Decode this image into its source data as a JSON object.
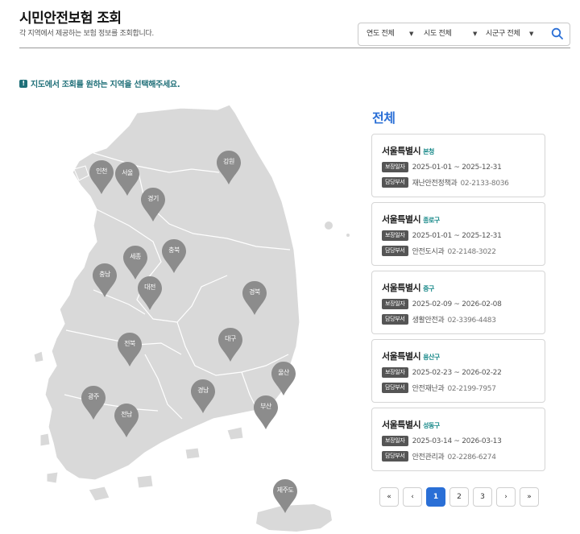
{
  "header": {
    "title": "시민안전보험 조회",
    "subtitle": "각 지역에서 제공하는 보험 정보를 조회합니다."
  },
  "filters": {
    "year": "연도 전체",
    "province": "시도 전체",
    "district": "시군구 전체",
    "caret": "▼",
    "search_icon": "search-icon"
  },
  "notice": {
    "icon": "!",
    "text": "지도에서 조회를 원하는 지역을 선택해주세요."
  },
  "map": {
    "land_color": "#d9d9d9",
    "border_color": "#ffffff",
    "pin_color": "#8c8c8c",
    "regions": [
      "인천",
      "서울",
      "강원",
      "경기",
      "세종",
      "충북",
      "충남",
      "대전",
      "경북",
      "전북",
      "대구",
      "울산",
      "광주",
      "경남",
      "부산",
      "전남",
      "제주도"
    ]
  },
  "list": {
    "title": "전체",
    "labels": {
      "period": "보장일자",
      "dept": "담당부서"
    },
    "cards": [
      {
        "city": "서울특별시",
        "district": "본청",
        "period": "2025-01-01 ~ 2025-12-31",
        "dept": "재난안전정책과",
        "phone": "02-2133-8036"
      },
      {
        "city": "서울특별시",
        "district": "종로구",
        "period": "2025-01-01 ~ 2025-12-31",
        "dept": "안전도시과",
        "phone": "02-2148-3022"
      },
      {
        "city": "서울특별시",
        "district": "중구",
        "period": "2025-02-09 ~ 2026-02-08",
        "dept": "생활안전과",
        "phone": "02-3396-4483"
      },
      {
        "city": "서울특별시",
        "district": "용산구",
        "period": "2025-02-23 ~ 2026-02-22",
        "dept": "안전재난과",
        "phone": "02-2199-7957"
      },
      {
        "city": "서울특별시",
        "district": "성동구",
        "period": "2025-03-14 ~ 2026-03-13",
        "dept": "안전관리과",
        "phone": "02-2286-6274"
      }
    ]
  },
  "pagination": {
    "first": "«",
    "prev": "‹",
    "pages": [
      "1",
      "2",
      "3"
    ],
    "current": "1",
    "next": "›",
    "last": "»"
  }
}
